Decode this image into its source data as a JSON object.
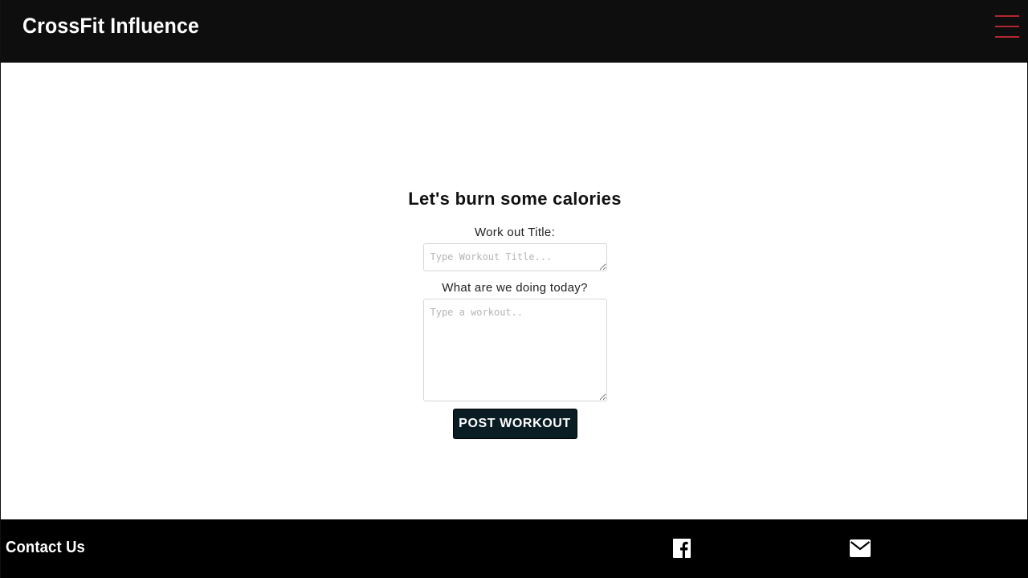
{
  "header": {
    "brand": "CrossFit Influence",
    "menu_icon": "hamburger-menu-icon",
    "menu_color": "#b3262d"
  },
  "form": {
    "title": "Let's burn some calories",
    "title_field": {
      "label": "Work out Title:",
      "placeholder": "Type Workout Title...",
      "value": ""
    },
    "workout_field": {
      "label": "What are we doing today?",
      "placeholder": "Type a workout..",
      "value": ""
    },
    "submit_label": "POST WORKOUT",
    "submit_color": "#0b1d24"
  },
  "footer": {
    "contact_label": "Contact Us",
    "social_icons": [
      "facebook-icon",
      "envelope-icon"
    ]
  }
}
